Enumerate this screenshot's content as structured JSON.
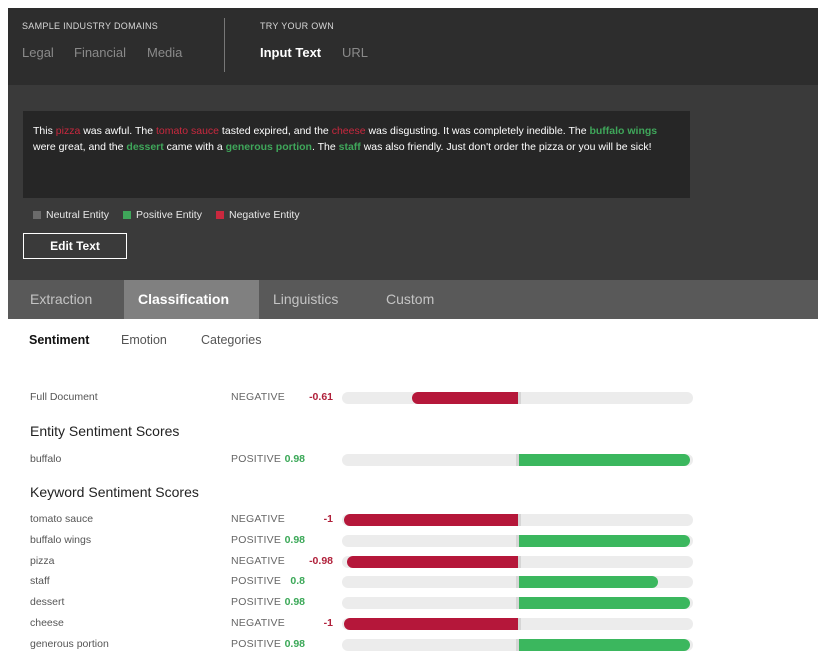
{
  "top": {
    "domains_header": "SAMPLE INDUSTRY DOMAINS",
    "domains": [
      "Legal",
      "Financial",
      "Media"
    ],
    "try_header": "TRY YOUR OWN",
    "try_options": [
      "Input Text",
      "URL"
    ]
  },
  "text": {
    "segments": [
      {
        "t": "This ",
        "k": "plain"
      },
      {
        "t": "pizza",
        "k": "neg"
      },
      {
        "t": " was awful. The ",
        "k": "plain"
      },
      {
        "t": "tomato sauce",
        "k": "neg"
      },
      {
        "t": " tasted expired, and the ",
        "k": "plain"
      },
      {
        "t": "cheese",
        "k": "neg"
      },
      {
        "t": " was disgusting. It was completely inedible. The ",
        "k": "plain"
      },
      {
        "t": "buffalo wings",
        "k": "pos"
      },
      {
        "t": " were great, and the ",
        "k": "plain"
      },
      {
        "t": "dessert",
        "k": "pos"
      },
      {
        "t": " came with a ",
        "k": "plain"
      },
      {
        "t": "generous portion",
        "k": "pos"
      },
      {
        "t": ". The ",
        "k": "plain"
      },
      {
        "t": "staff",
        "k": "pos"
      },
      {
        "t": " was also friendly. Just don't order the pizza or you will be sick!",
        "k": "plain"
      }
    ]
  },
  "legend": {
    "neutral": "Neutral Entity",
    "positive": "Positive Entity",
    "negative": "Negative Entity",
    "colors": {
      "neutral": "#6b6b6b",
      "positive": "#3fa65a",
      "negative": "#c9283e"
    }
  },
  "edit_button": "Edit Text",
  "tabs": [
    "Extraction",
    "Classification",
    "Linguistics",
    "Custom"
  ],
  "subtabs": [
    "Sentiment",
    "Emotion",
    "Categories"
  ],
  "sections": {
    "entity_title": "Entity Sentiment Scores",
    "keyword_title": "Keyword Sentiment Scores"
  },
  "colors": {
    "negative_bar": "#b5173a",
    "positive_bar": "#3bb75e"
  },
  "full_document": {
    "label": "Full Document",
    "sentiment": "NEGATIVE",
    "score": "-0.61",
    "value": -0.61
  },
  "entities": [
    {
      "label": "buffalo",
      "sentiment": "POSITIVE",
      "score": "0.98",
      "value": 0.98
    }
  ],
  "keywords": [
    {
      "label": "tomato sauce",
      "sentiment": "NEGATIVE",
      "score": "-1",
      "value": -1
    },
    {
      "label": "buffalo wings",
      "sentiment": "POSITIVE",
      "score": "0.98",
      "value": 0.98
    },
    {
      "label": "pizza",
      "sentiment": "NEGATIVE",
      "score": "-0.98",
      "value": -0.98
    },
    {
      "label": "staff",
      "sentiment": "POSITIVE",
      "score": "0.8",
      "value": 0.8
    },
    {
      "label": "dessert",
      "sentiment": "POSITIVE",
      "score": "0.98",
      "value": 0.98
    },
    {
      "label": "cheese",
      "sentiment": "NEGATIVE",
      "score": "-1",
      "value": -1
    },
    {
      "label": "generous portion",
      "sentiment": "POSITIVE",
      "score": "0.98",
      "value": 0.98
    }
  ]
}
